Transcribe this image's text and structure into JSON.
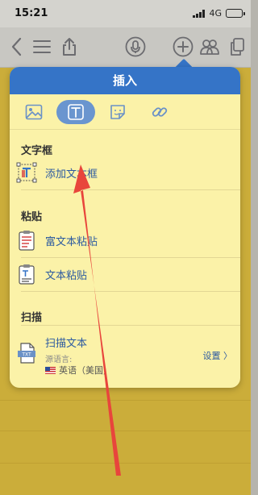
{
  "status_bar": {
    "time": "15:21",
    "network": "4G"
  },
  "toolbar": {
    "icons": [
      "back-icon",
      "list-icon",
      "share-icon",
      "mic-icon",
      "add-icon",
      "contacts-icon",
      "copy-icon"
    ]
  },
  "popover": {
    "title": "插入",
    "tabs": [
      "image-icon",
      "textbox-icon",
      "sticker-icon",
      "link-icon"
    ],
    "active_tab": "textbox-icon",
    "sections": {
      "textbox": {
        "header": "文字框",
        "items": [
          {
            "label": "添加文本框"
          }
        ]
      },
      "paste": {
        "header": "粘贴",
        "items": [
          {
            "label": "富文本粘贴"
          },
          {
            "label": "文本粘贴"
          }
        ]
      },
      "scan": {
        "header": "扫描",
        "items": [
          {
            "label": "扫描文本",
            "source_language_label": "源语言:",
            "language": "英语（美国）",
            "settings_label": "设置 〉"
          }
        ]
      }
    }
  },
  "colors": {
    "accent": "#3574c7",
    "popover_bg": "#fbf2a8",
    "note_bg": "#cbad3a",
    "annotation_arrow": "#e8453c"
  }
}
